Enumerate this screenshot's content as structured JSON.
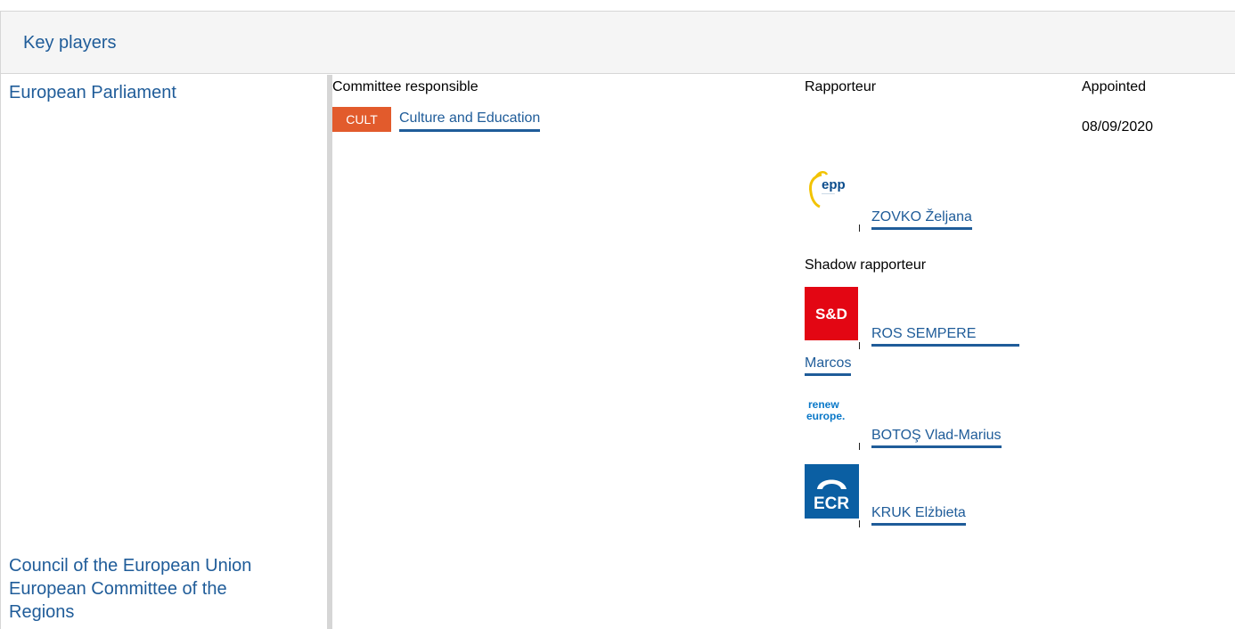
{
  "header": {
    "title": "Key players"
  },
  "institutions": {
    "parliament": "European Parliament",
    "council": "Council of the European Union",
    "regions_line1": "European Committee of the",
    "regions_line2": "Regions"
  },
  "columns": {
    "committee": "Committee responsible",
    "rapporteur": "Rapporteur",
    "appointed": "Appointed"
  },
  "committee": {
    "code": "CULT",
    "name": "Culture and Education",
    "appointed_date": "08/09/2020",
    "badge_color": "#e25b2c"
  },
  "rapporteur": {
    "name": "ZOVKO Željana",
    "group_icon": "epp-logo"
  },
  "shadow_label": "Shadow rapporteur",
  "shadows": [
    {
      "name_line1": "ROS SEMPERE",
      "name_line2": "Marcos",
      "group_icon": "sd-logo",
      "group_label": "S&D"
    },
    {
      "name": "BOTOŞ Vlad-Marius",
      "group_icon": "renew-europe-logo",
      "group_label_line1": "renew",
      "group_label_line2": "europe."
    },
    {
      "name": "KRUK Elżbieta",
      "group_icon": "ecr-logo",
      "group_label": "ECR"
    }
  ],
  "logos": {
    "epp_text": "epp"
  },
  "colors": {
    "link": "#1f5c99",
    "border": "#d6d6d6",
    "header_bg": "#f5f5f5",
    "sd_red": "#e30613",
    "renew_blue": "#0a78c8",
    "ecr_blue": "#0b5fa3"
  }
}
